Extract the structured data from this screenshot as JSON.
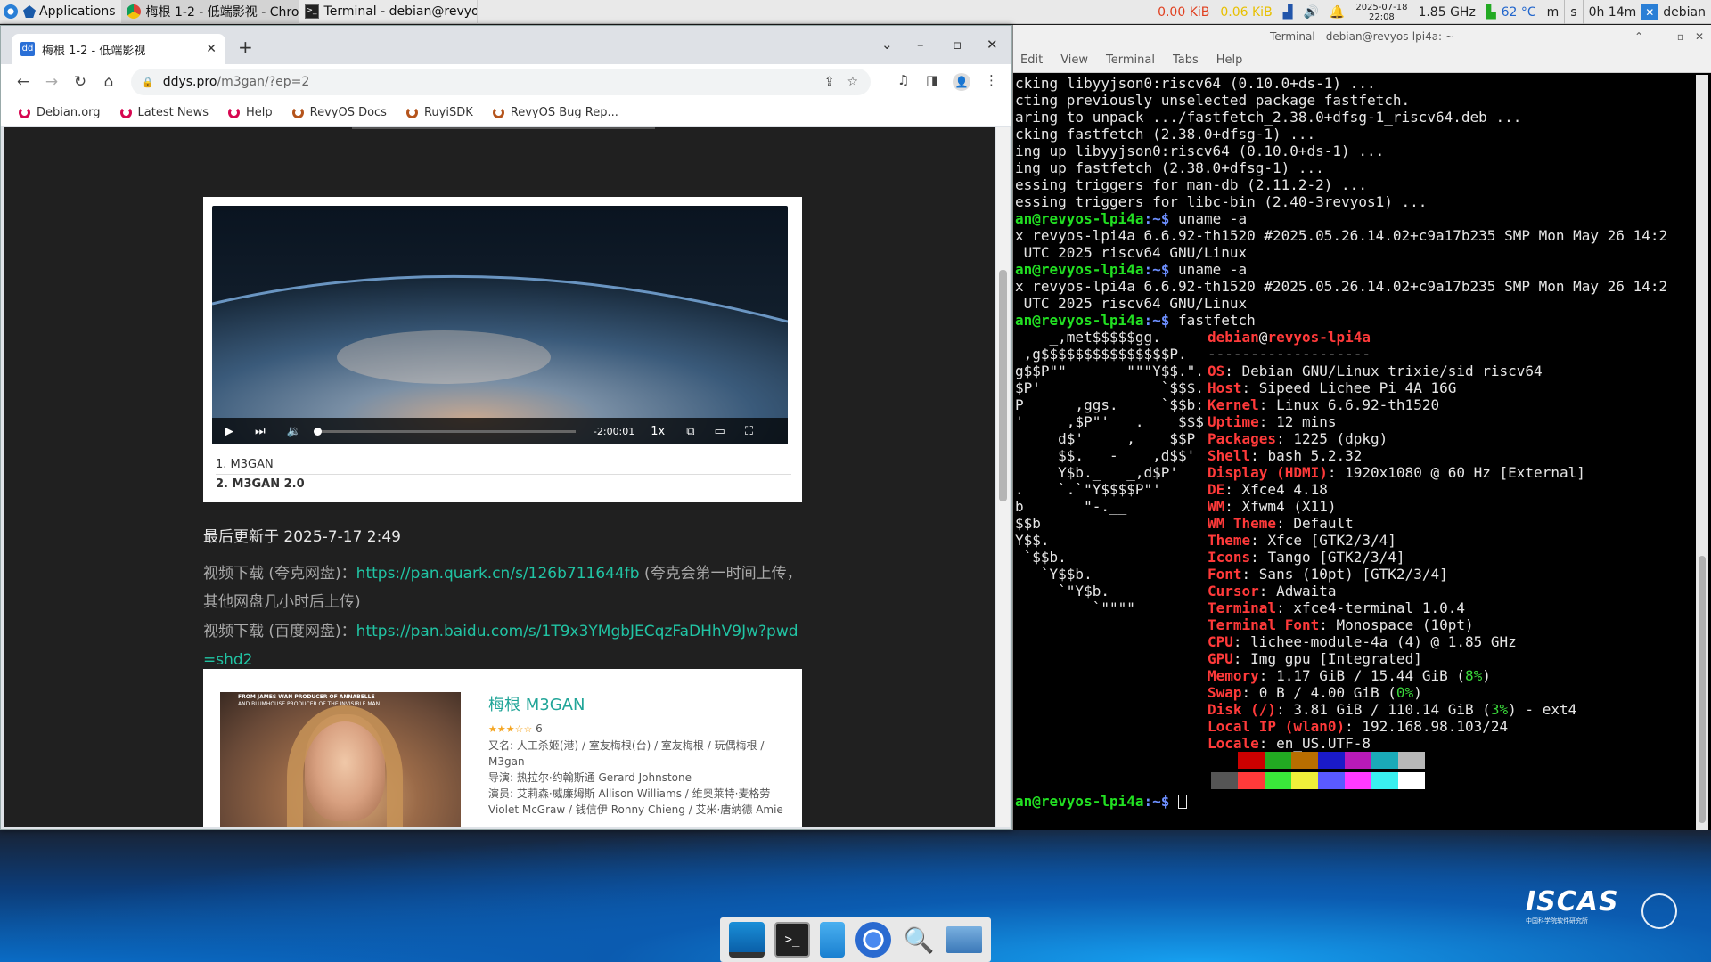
{
  "top_panel": {
    "applications_label": "Applications",
    "tasks": [
      {
        "label": "梅根 1-2 - 低端影视 - Chro..."
      },
      {
        "label": "Terminal - debian@revyos..."
      }
    ],
    "net_down": "0.00 KiB",
    "net_up": "0.06 KiB",
    "datetime_date": "2025-07-18",
    "datetime_time": "22:08",
    "cpu_freq": "1.85 GHz",
    "temperature": "62 °C",
    "m_label": "m",
    "s_label": "s",
    "uptime": "0h 14m",
    "user": "debian"
  },
  "browser": {
    "tab_title": "梅根 1-2 - 低端影视",
    "url_host": "ddys.pro",
    "url_path": "/m3gan/?ep=2",
    "bookmarks": [
      {
        "label": "Debian.org",
        "color": "#d70751"
      },
      {
        "label": "Latest News",
        "color": "#d70751"
      },
      {
        "label": "Help",
        "color": "#d70751"
      },
      {
        "label": "RevyOS Docs",
        "color": "#b5541c"
      },
      {
        "label": "RuyiSDK",
        "color": "#b5541c"
      },
      {
        "label": "RevyOS Bug Rep...",
        "color": "#b5541c"
      }
    ],
    "video": {
      "time_remaining": "-2:00:01",
      "speed": "1x",
      "progress": 0.0
    },
    "playlist": [
      "1. M3GAN",
      "2. M3GAN 2.0"
    ],
    "updated": "最后更新于 2025-7-17 2:49",
    "download_quark_label": "视频下载 (夸克网盘)：",
    "download_quark_url": "https://pan.quark.cn/s/126b711644fb",
    "download_quark_note": " (夸克会第一时间上传，其他网盘几小时后上传)",
    "download_baidu_label": "视频下载 (百度网盘)：",
    "download_baidu_url": "https://pan.baidu.com/s/1T9x3YMgbJECqzFaDHhV9Jw?pwd=shd2",
    "movie": {
      "title": "梅根 M3GAN",
      "stars": "★★★☆☆",
      "rating": "6",
      "aka": "又名: 人工杀姬(港) / 室友梅根(台) / 室友梅根 / 玩偶梅根 / M3gan",
      "director": "导演: 热拉尔·约翰斯通 Gerard Johnstone",
      "cast": "演员: 艾莉森·威廉姆斯 Allison Williams / 维奥莱特·麦格劳 Violet McGraw / 钱信伊 Ronny Chieng / 艾米·唐纳德 Amie",
      "poster_top": "FROM JAMES WAN PRODUCER OF ANNABELLE",
      "poster_sub": "AND BLUMHOUSE PRODUCER OF THE INVISIBLE MAN"
    }
  },
  "terminal": {
    "title": "Terminal - debian@revyos-lpi4a: ~",
    "menu": [
      "Edit",
      "View",
      "Terminal",
      "Tabs",
      "Help"
    ],
    "prompt_user": "an@revyos-lpi4a",
    "prompt_sep": ":~$",
    "lines_top": [
      "cking libyyjson0:riscv64 (0.10.0+ds-1) ...",
      "cting previously unselected package fastfetch.",
      "aring to unpack .../fastfetch_2.38.0+dfsg-1_riscv64.deb ...",
      "cking fastfetch (2.38.0+dfsg-1) ...",
      "ing up libyyjson0:riscv64 (0.10.0+ds-1) ...",
      "ing up fastfetch (2.38.0+dfsg-1) ...",
      "essing triggers for man-db (2.11.2-2) ...",
      "essing triggers for libc-bin (2.40-3revyos1) ..."
    ],
    "cmd1": "uname -a",
    "uname_out1": "x revyos-lpi4a 6.6.92-th1520 #2025.05.26.14.02+c9a17b235 SMP Mon May 26 14:2",
    "uname_out2": " UTC 2025 riscv64 GNU/Linux",
    "cmd2": "uname -a",
    "cmd3": "fastfetch",
    "ff_user": "debian",
    "ff_at": "@",
    "ff_host": "revyos-lpi4a",
    "ff_sep": "-------------------",
    "logo": [
      "    _,met$$$$$gg.",
      " ,g$$$$$$$$$$$$$$$P.",
      "g$$P\"\"       \"\"\"Y$$.\".",
      "$P'              `$$$.",
      "P      ,ggs.     `$$b:",
      "'     ,$P\"'   .    $$$",
      "     d$'     ,    $$P",
      "     $$.   -    ,d$$'",
      "     Y$b._   _,d$P'",
      ".    `.`\"Y$$$$P\"'",
      "b       \"-.__",
      "$$b",
      "Y$$.",
      " `$$b.",
      "   `Y$$b.",
      "     `\"Y$b._",
      "         `\"\"\"\""
    ],
    "info": [
      {
        "k": "OS",
        "v": "Debian GNU/Linux trixie/sid riscv64"
      },
      {
        "k": "Host",
        "v": "Sipeed Lichee Pi 4A 16G"
      },
      {
        "k": "Kernel",
        "v": "Linux 6.6.92-th1520"
      },
      {
        "k": "Uptime",
        "v": "12 mins"
      },
      {
        "k": "Packages",
        "v": "1225 (dpkg)"
      },
      {
        "k": "Shell",
        "v": "bash 5.2.32"
      },
      {
        "k": "Display (HDMI)",
        "v": "1920x1080 @ 60 Hz [External]"
      },
      {
        "k": "DE",
        "v": "Xfce4 4.18"
      },
      {
        "k": "WM",
        "v": "Xfwm4 (X11)"
      },
      {
        "k": "WM Theme",
        "v": "Default"
      },
      {
        "k": "Theme",
        "v": "Xfce [GTK2/3/4]"
      },
      {
        "k": "Icons",
        "v": "Tango [GTK2/3/4]"
      },
      {
        "k": "Font",
        "v": "Sans (10pt) [GTK2/3/4]"
      },
      {
        "k": "Cursor",
        "v": "Adwaita"
      },
      {
        "k": "Terminal",
        "v": "xfce4-terminal 1.0.4"
      },
      {
        "k": "Terminal Font",
        "v": "Monospace (10pt)"
      },
      {
        "k": "CPU",
        "v": "lichee-module-4a (4) @ 1.85 GHz"
      },
      {
        "k": "GPU",
        "v": "Img gpu [Integrated]"
      },
      {
        "k": "Memory",
        "v": "1.17 GiB / 15.44 GiB (",
        "pct": "8%",
        "tail": ")"
      },
      {
        "k": "Swap",
        "v": "0 B / 4.00 GiB (",
        "pct": "0%",
        "tail": ")"
      },
      {
        "k": "Disk (/)",
        "v": "3.81 GiB / 110.14 GiB (",
        "pct": "3%",
        "tail": ") - ext4"
      },
      {
        "k": "Local IP (wlan0)",
        "v": "192.168.98.103/24"
      },
      {
        "k": "Locale",
        "v": "en_US.UTF-8"
      }
    ],
    "palette_top": [
      "#000000",
      "#cc0000",
      "#22aa22",
      "#b86e00",
      "#1a1ac8",
      "#b81ab8",
      "#1aaab8",
      "#b8b8b8"
    ],
    "palette_bottom": [
      "#555555",
      "#ff3a3a",
      "#3ae83a",
      "#f0f03a",
      "#5a5aff",
      "#ff3aff",
      "#3af0f0",
      "#ffffff"
    ]
  },
  "desktop": {
    "dock_items": [
      "show-desktop",
      "terminal",
      "file-manager",
      "chromium",
      "app-finder",
      "home-folder"
    ],
    "logo_text": "ISCAS",
    "logo_sub": "中国科学院软件研究所"
  }
}
